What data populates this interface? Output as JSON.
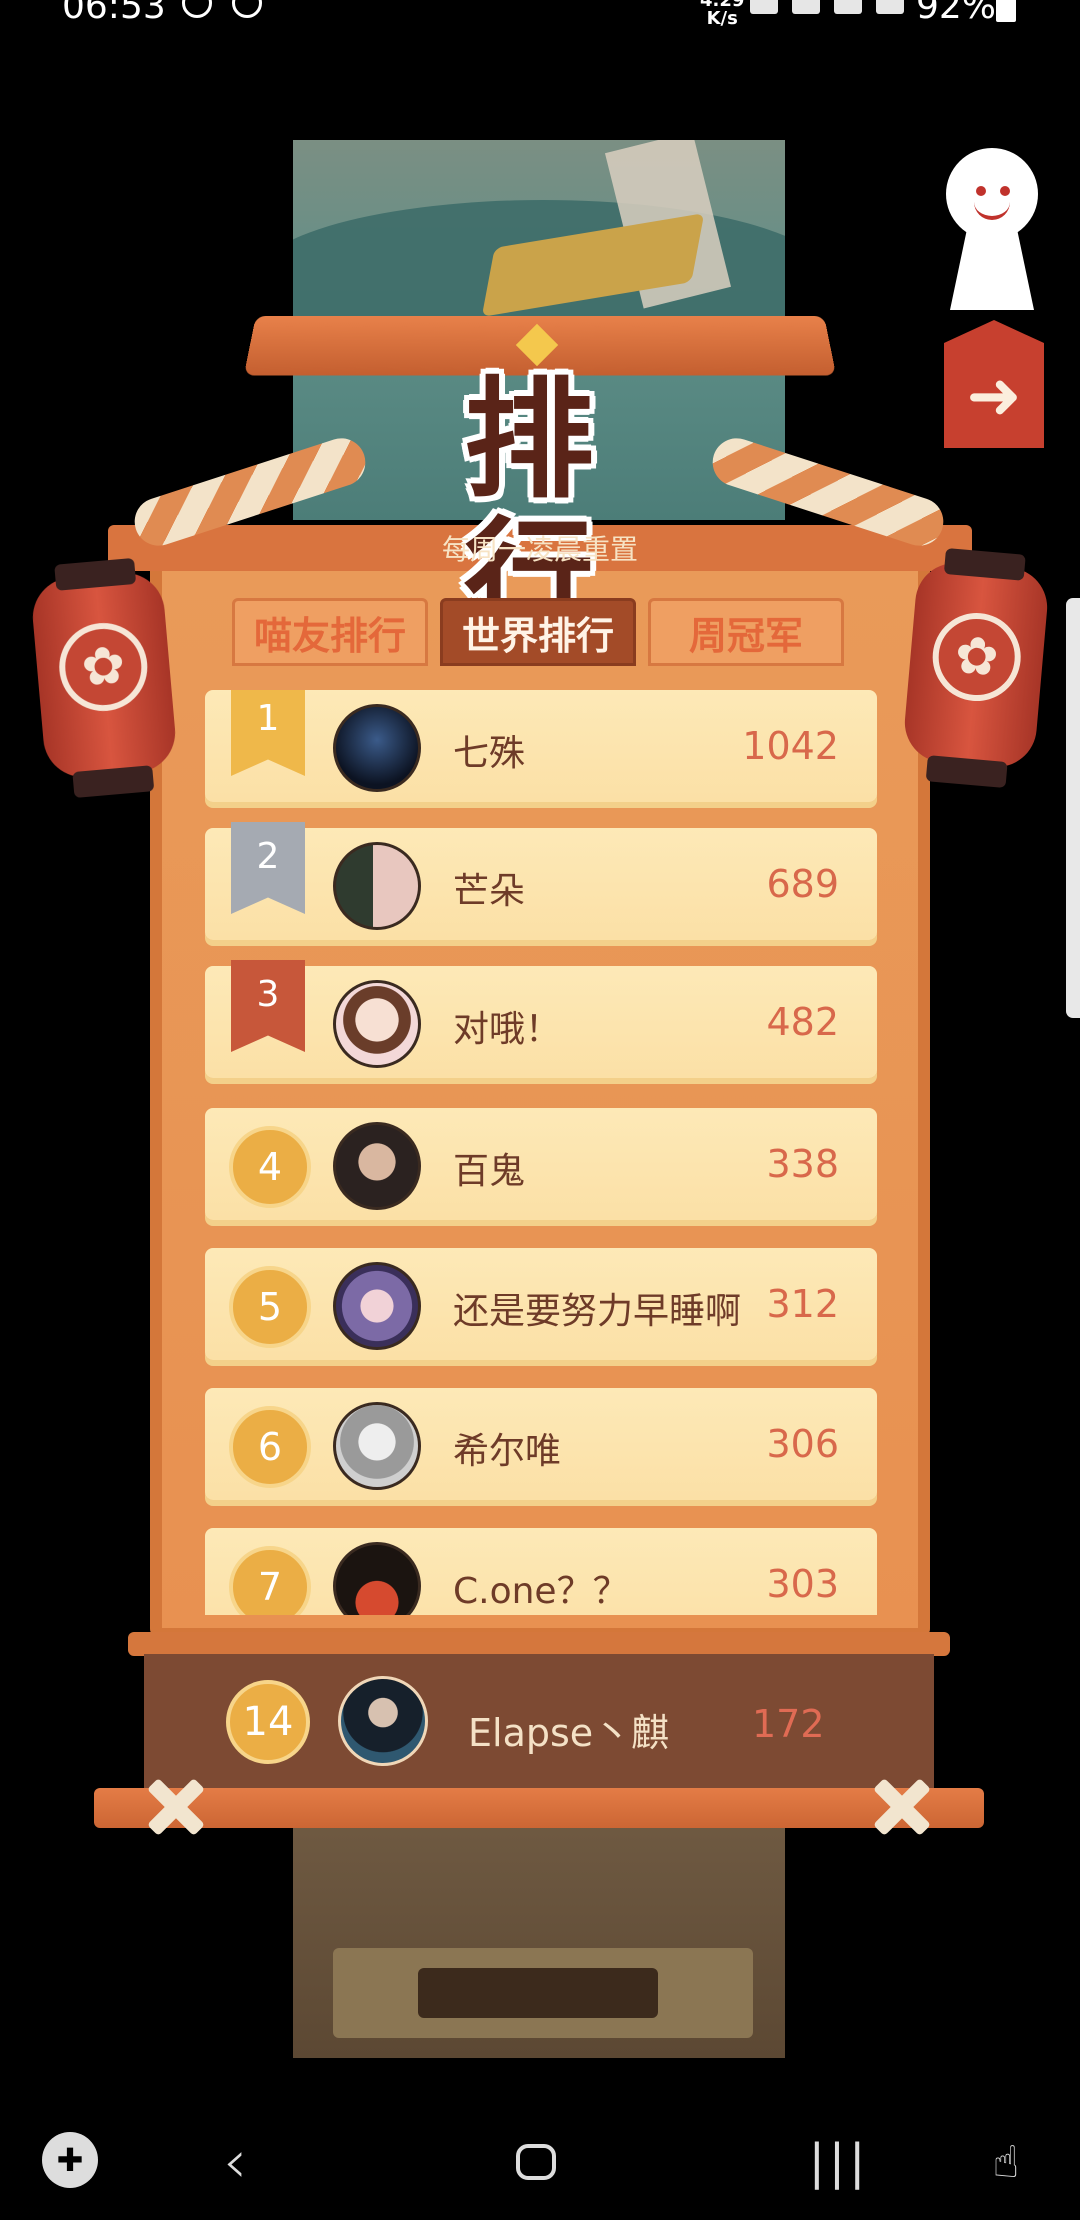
{
  "status_bar": {
    "time": "06:53",
    "speed_value": "4.29",
    "speed_unit": "K/s",
    "battery": "92%"
  },
  "title": "排 行",
  "subtitle": "每周一凌晨重置",
  "tabs": [
    {
      "label": "喵友排行",
      "active": false
    },
    {
      "label": "世界排行",
      "active": true
    },
    {
      "label": "周冠军",
      "active": false
    }
  ],
  "ranking": [
    {
      "rank": "1",
      "name": "七殊",
      "score": "1042",
      "badge": "gold"
    },
    {
      "rank": "2",
      "name": "芒朵",
      "score": "689",
      "badge": "silver"
    },
    {
      "rank": "3",
      "name": "对哦！",
      "score": "482",
      "badge": "bronze"
    },
    {
      "rank": "4",
      "name": "百鬼",
      "score": "338",
      "badge": "circle"
    },
    {
      "rank": "5",
      "name": "还是要努力早睡啊",
      "score": "312",
      "badge": "circle"
    },
    {
      "rank": "6",
      "name": "希尔唯",
      "score": "306",
      "badge": "circle"
    },
    {
      "rank": "7",
      "name": "C.one？？",
      "score": "303",
      "badge": "circle"
    }
  ],
  "self": {
    "rank": "14",
    "name": "Elapse丶麒",
    "score": "172"
  },
  "colors": {
    "board": "#e99a59",
    "row": "#fde9b7",
    "score": "#d8684b",
    "active_tab": "#a34b28"
  },
  "icons": {
    "back": "arrow-left-icon",
    "lantern": "sakura-icon",
    "nav_game": "gamepad-icon",
    "nav_back": "chevron-left-icon",
    "nav_home": "home-icon",
    "nav_recents": "recents-icon",
    "nav_lock": "touch-lock-icon"
  }
}
